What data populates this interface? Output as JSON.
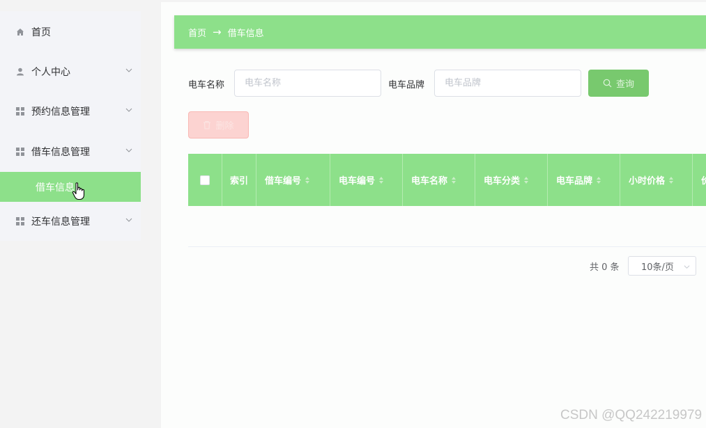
{
  "sidebar": {
    "items": [
      {
        "label": "首页",
        "icon": "home-icon"
      },
      {
        "label": "个人中心",
        "icon": "user-icon"
      },
      {
        "label": "预约信息管理",
        "icon": "grid-icon"
      },
      {
        "label": "借车信息管理",
        "icon": "grid-icon"
      },
      {
        "label": "还车信息管理",
        "icon": "grid-icon"
      }
    ],
    "active_sub": "借车信息"
  },
  "breadcrumb": {
    "home": "首页",
    "arrow": "→",
    "current": "借车信息"
  },
  "search": {
    "name_label": "电车名称",
    "name_placeholder": "电车名称",
    "brand_label": "电车品牌",
    "brand_placeholder": "电车品牌",
    "query_label": "查询",
    "delete_label": "删除"
  },
  "table": {
    "columns": [
      "索引",
      "借车编号",
      "电车编号",
      "电车名称",
      "电车分类",
      "电车品牌",
      "小时价格",
      "价"
    ]
  },
  "pagination": {
    "total": "共 0 条",
    "page_size": "10条/页"
  },
  "watermark": "CSDN @QQ242219979",
  "colors": {
    "accent": "#8de08a",
    "query": "#78c96e",
    "delete": "#fcd3d1"
  }
}
